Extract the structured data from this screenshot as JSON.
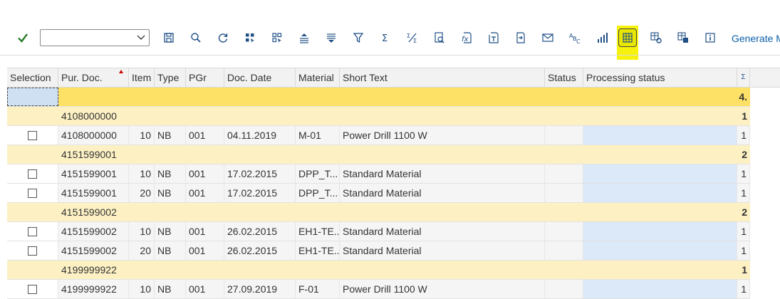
{
  "toolbar": {
    "layout_input_value": "",
    "generate_label": "Generate M",
    "icons": [
      "check-icon",
      "save-icon",
      "find-icon",
      "refresh-icon",
      "select-all-icon",
      "deselect-all-icon",
      "sort-ascending-icon",
      "sort-descending-icon",
      "filter-icon",
      "sum-icon",
      "subtotals-icon",
      "print-preview-icon",
      "excel-icon",
      "word-processing-icon",
      "local-file-icon",
      "mail-icon",
      "abc-analysis-icon",
      "graphic-icon",
      "layout-grid-icon",
      "change-layout-icon",
      "select-layout-icon",
      "information-icon"
    ],
    "highlight_color": "#f6f20d"
  },
  "grid": {
    "columns": [
      "Selection",
      "Pur. Doc.",
      "Item",
      "Type",
      "PGr",
      "Doc. Date",
      "Material",
      "Short Text",
      "Status",
      "Processing status",
      "Σ"
    ],
    "grand_total": "4.",
    "rows": [
      {
        "kind": "sub",
        "doc": "4108000000",
        "count": "1"
      },
      {
        "kind": "item",
        "doc": "4108000000",
        "item": "10",
        "type": "NB",
        "pgr": "001",
        "date": "04.11.2019",
        "material": "M-01",
        "text": "Power Drill 1100 W",
        "count": "1"
      },
      {
        "kind": "sub",
        "doc": "4151599001",
        "count": "2"
      },
      {
        "kind": "item",
        "doc": "4151599001",
        "item": "10",
        "type": "NB",
        "pgr": "001",
        "date": "17.02.2015",
        "material": "DPP_T...",
        "text": "Standard Material",
        "count": "1"
      },
      {
        "kind": "item",
        "doc": "4151599001",
        "item": "20",
        "type": "NB",
        "pgr": "001",
        "date": "17.02.2015",
        "material": "DPP_T...",
        "text": "Standard Material",
        "count": "1"
      },
      {
        "kind": "sub",
        "doc": "4151599002",
        "count": "2"
      },
      {
        "kind": "item",
        "doc": "4151599002",
        "item": "10",
        "type": "NB",
        "pgr": "001",
        "date": "26.02.2015",
        "material": "EH1-TE...",
        "text": "Standard Material",
        "count": "1"
      },
      {
        "kind": "item",
        "doc": "4151599002",
        "item": "20",
        "type": "NB",
        "pgr": "001",
        "date": "26.02.2015",
        "material": "EH1-TE...",
        "text": "Standard Material",
        "count": "1"
      },
      {
        "kind": "sub",
        "doc": "4199999922",
        "count": "1"
      },
      {
        "kind": "item",
        "doc": "4199999922",
        "item": "10",
        "type": "NB",
        "pgr": "001",
        "date": "27.09.2019",
        "material": "F-01",
        "text": "Power Drill 1100 W",
        "count": "1"
      }
    ]
  }
}
